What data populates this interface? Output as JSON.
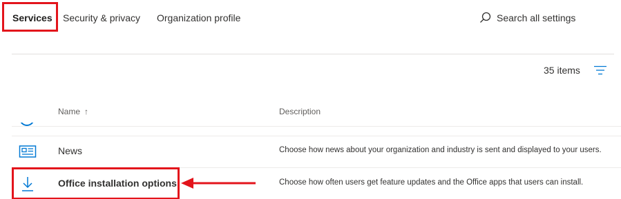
{
  "tabs": [
    {
      "label": "Services",
      "selected": true
    },
    {
      "label": "Security & privacy",
      "selected": false
    },
    {
      "label": "Organization profile",
      "selected": false
    }
  ],
  "search": {
    "label": "Search all settings",
    "icon": "search-icon"
  },
  "list_summary": {
    "count": "35 items",
    "filter_icon": "filter-icon"
  },
  "table": {
    "columns": [
      {
        "label": "Name",
        "sort": "ascending",
        "sort_glyph": "↑"
      },
      {
        "label": "Description"
      }
    ],
    "rows": [
      {
        "name": "News",
        "icon": "newspaper-icon",
        "description": "Choose how news about your organization and industry is sent and displayed to your users."
      },
      {
        "name": "Office installation options",
        "icon": "download-icon",
        "description": "Choose how often users get feature updates and the Office apps that users can install."
      }
    ]
  },
  "colors": {
    "accent": "#0078d4",
    "annotation": "#e3141b",
    "text": "#323130",
    "divider": "#edebe9"
  }
}
